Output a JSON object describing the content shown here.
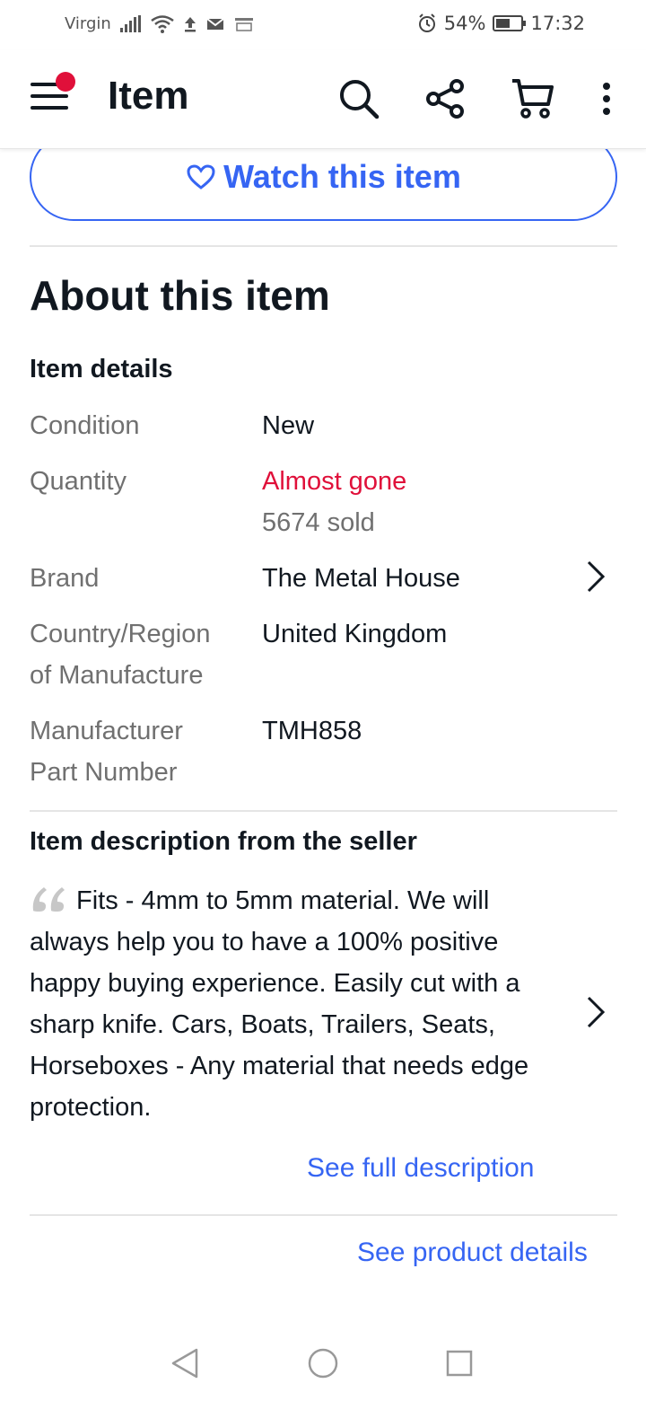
{
  "status_bar": {
    "carrier": "Virgin",
    "battery_percent": "54%",
    "battery_level": 0.54,
    "time": "17:32",
    "icons": [
      "signal-icon",
      "wifi-icon",
      "upload-icon",
      "mail-icon",
      "amazon-icon",
      "alarm-icon",
      "battery-icon"
    ]
  },
  "app_bar": {
    "title": "Item",
    "notification_color": "#e0103a",
    "icons": [
      "menu-icon",
      "search-icon",
      "share-icon",
      "cart-icon",
      "more-icon"
    ]
  },
  "watch_button": {
    "label": "Watch this item",
    "icon": "heart-icon"
  },
  "about": {
    "title": "About this item",
    "item_details_title": "Item details",
    "details": [
      {
        "label": "Condition",
        "value": "New"
      },
      {
        "label": "Quantity",
        "value": "Almost gone",
        "subvalue": "5674 sold"
      },
      {
        "label": "Brand",
        "value": "The Metal House"
      },
      {
        "label_line1": "Country/Region",
        "label_line2": "of Manufacture",
        "value": "United Kingdom"
      },
      {
        "label_line1": "Manufacturer",
        "label_line2": "Part Number",
        "value": "TMH858"
      }
    ]
  },
  "description": {
    "title": "Item description from the seller",
    "text": "Fits - 4mm to 5mm material. We will always help you to have a 100% positive happy buying experience. Easily cut with a sharp knife. Cars, Boats, Trailers, Seats, Horseboxes - Any material that needs edge protection.",
    "full_link": "See full description"
  },
  "product_details_link": "See product details",
  "colors": {
    "accent": "#3665f3",
    "alert": "#e0103a",
    "secondary_text": "#707070",
    "primary_text": "#111820"
  },
  "nav_bar": {
    "icons": [
      "back-icon",
      "home-icon",
      "recents-icon"
    ]
  }
}
